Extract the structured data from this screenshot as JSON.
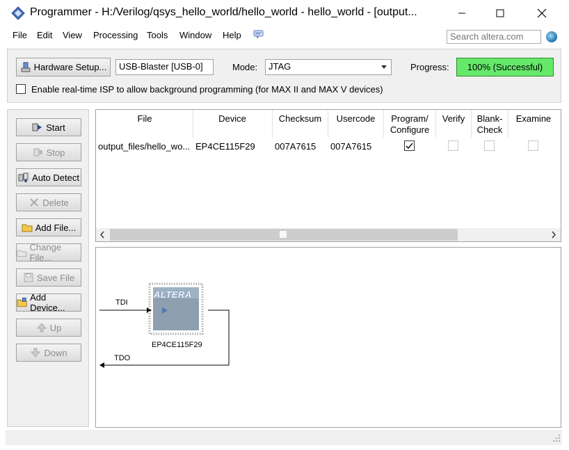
{
  "window": {
    "title": "Programmer - H:/Verilog/qsys_hello_world/hello_world - hello_world - [output...",
    "icons": [
      "programmer-app-icon",
      "minimize-icon",
      "maximize-icon",
      "close-icon"
    ]
  },
  "menu": {
    "items": [
      "File",
      "Edit",
      "View",
      "Processing",
      "Tools",
      "Window",
      "Help"
    ],
    "search_placeholder": "Search altera.com"
  },
  "toolbar": {
    "hardware_setup_label": "Hardware Setup...",
    "hardware_value": "USB-Blaster [USB-0]",
    "mode_label": "Mode:",
    "mode_value": "JTAG",
    "progress_label": "Progress:",
    "progress_value": "100% (Successful)",
    "progress_fraction": 1.0,
    "isp_label": "Enable real-time ISP to allow background programming (for MAX II and MAX V devices)",
    "colors": {
      "progress_fill": "#66e86a",
      "progress_border": "#2e8b2e"
    }
  },
  "sidebar": {
    "buttons": [
      {
        "label": "Start",
        "enabled": true
      },
      {
        "label": "Stop",
        "enabled": false
      },
      {
        "label": "Auto Detect",
        "enabled": true
      },
      {
        "label": "Delete",
        "enabled": false
      },
      {
        "label": "Add File...",
        "enabled": true
      },
      {
        "label": "Change File...",
        "enabled": false
      },
      {
        "label": "Save File",
        "enabled": false
      },
      {
        "label": "Add Device...",
        "enabled": true
      },
      {
        "label": "Up",
        "enabled": false
      },
      {
        "label": "Down",
        "enabled": false
      }
    ]
  },
  "table": {
    "headers": [
      "File",
      "Device",
      "Checksum",
      "Usercode",
      "Program/\nConfigure",
      "Verify",
      "Blank-\nCheck",
      "Examine"
    ],
    "rows": [
      {
        "file": "output_files/hello_wo...",
        "device": "EP4CE115F29",
        "checksum": "007A7615",
        "usercode": "007A7615",
        "program": true,
        "verify": false,
        "blank_check": false,
        "examine": false
      }
    ]
  },
  "chain": {
    "tdi_label": "TDI",
    "tdo_label": "TDO",
    "device_label": "EP4CE115F29",
    "chip_brand": "ALTERA"
  }
}
